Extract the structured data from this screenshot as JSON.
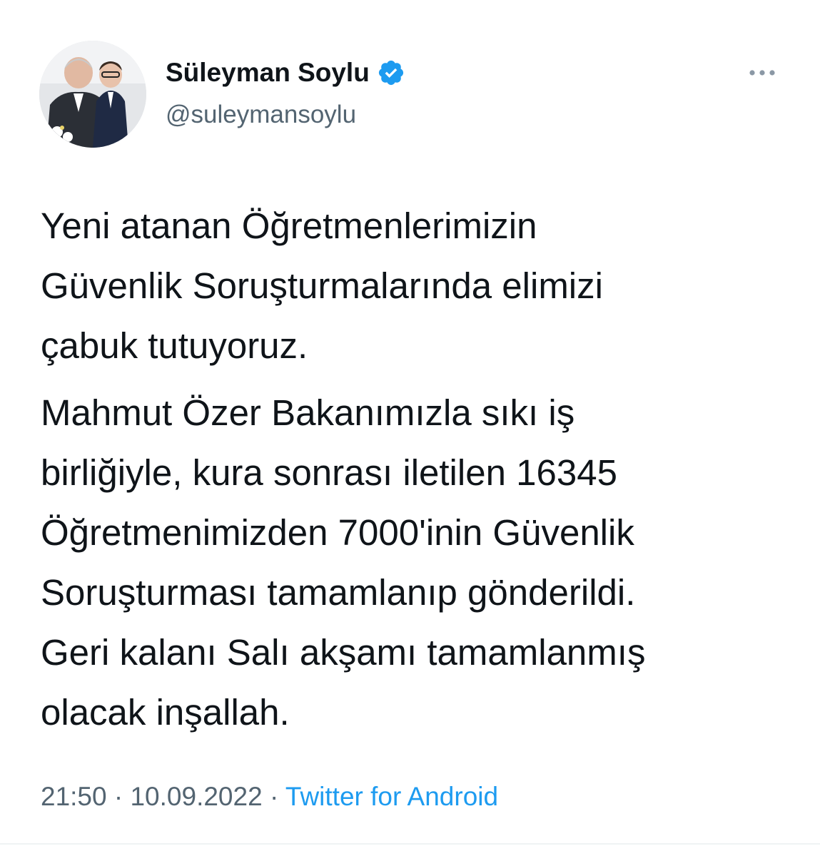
{
  "author": {
    "display_name": "Süleyman Soylu",
    "handle": "@suleymansoylu",
    "verified": true
  },
  "tweet": {
    "paragraphs": [
      "Yeni atanan Öğretmenlerimizin\nGüvenlik Soruşturmalarında elimizi\nçabuk tutuyoruz.",
      "Mahmut Özer Bakanımızla sıkı iş\nbirliğiyle, kura sonrası iletilen 16345\nÖğretmenimizden 7000'inin Güvenlik\nSoruşturması tamamlanıp gönderildi.\nGeri kalanı Salı akşamı tamamlanmış\nolacak inşallah."
    ]
  },
  "meta": {
    "time": "21:50",
    "separator": " · ",
    "date": "10.09.2022",
    "source": "Twitter for Android"
  },
  "icons": {
    "verified": "verified-badge-icon",
    "more": "more-options-icon"
  },
  "colors": {
    "accent": "#1d9bf0",
    "secondary_text": "#536471",
    "primary_text": "#0f1419"
  }
}
